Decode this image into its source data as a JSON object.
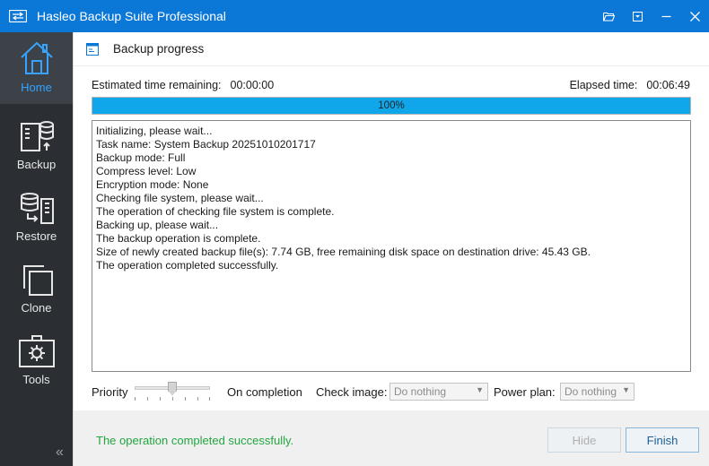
{
  "window": {
    "title": "Hasleo Backup Suite Professional"
  },
  "titlebar_buttons": [
    "folder-icon",
    "dropdown-icon",
    "minimize-icon",
    "close-icon"
  ],
  "sidebar": {
    "items": [
      {
        "label": "Home",
        "icon": "home-icon",
        "active": true
      },
      {
        "label": "Backup",
        "icon": "backup-icon",
        "active": false
      },
      {
        "label": "Restore",
        "icon": "restore-icon",
        "active": false
      },
      {
        "label": "Clone",
        "icon": "clone-icon",
        "active": false
      },
      {
        "label": "Tools",
        "icon": "tools-icon",
        "active": false
      }
    ],
    "collapse_glyph": "«"
  },
  "section": {
    "title": "Backup progress"
  },
  "timing": {
    "estimated_label": "Estimated time remaining:",
    "estimated_value": "00:00:00",
    "elapsed_label": "Elapsed time:",
    "elapsed_value": "00:06:49"
  },
  "progress": {
    "percent": 100,
    "text": "100%"
  },
  "log": [
    "Initializing, please wait...",
    "Task name: System Backup 20251010201717",
    "Backup mode: Full",
    "Compress level: Low",
    "Encryption mode: None",
    "Checking file system, please wait...",
    "The operation of checking file system is complete.",
    "Backing up, please wait...",
    "The backup operation is complete.",
    "Size of newly created backup file(s): 7.74 GB, free remaining disk space on destination drive: 45.43 GB.",
    "The operation completed successfully."
  ],
  "options": {
    "priority_label": "Priority",
    "priority_level": 0.5,
    "on_completion_label": "On completion",
    "check_image_label": "Check image:",
    "check_image_value": "Do nothing",
    "power_plan_label": "Power plan:",
    "power_plan_value": "Do nothing"
  },
  "footer": {
    "status": "The operation completed successfully.",
    "hide_label": "Hide",
    "finish_label": "Finish"
  },
  "colors": {
    "titlebar": "#0b78d7",
    "sidebar": "#2b2f33",
    "active_accent": "#35a3ff",
    "progress_fill": "#10a7ea",
    "status_success": "#22a640"
  }
}
